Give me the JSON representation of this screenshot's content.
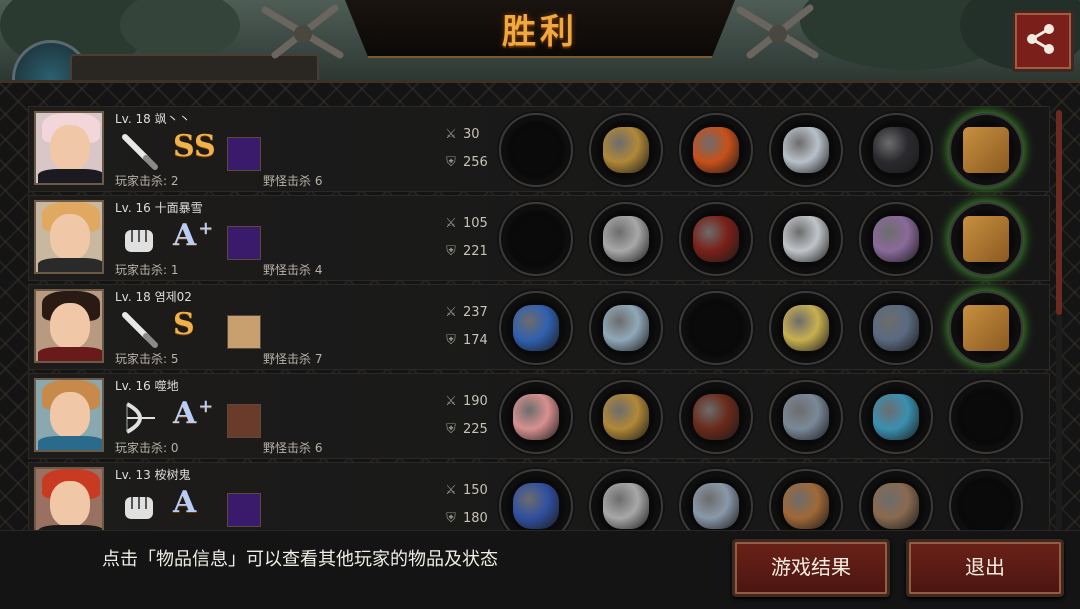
{
  "header": {
    "title": "胜利",
    "share_icon": "share-icon"
  },
  "players": [
    {
      "level": "Lv. 18 飒丶丶",
      "weapon_icon": "knife-icon",
      "grade": "SS",
      "grade_plus": "",
      "grade_color": "#f2b24a",
      "player_kills_label": "玩家击杀: 2",
      "monster_kills_label": "野怪击杀 6",
      "attack": "30",
      "defense": "256",
      "items": [
        "empty",
        "gold-helmet",
        "flaming-armor",
        "spiked-blade",
        "black-boots",
        "mystery-box"
      ]
    },
    {
      "level": "Lv. 16 十面暴雪",
      "weapon_icon": "fist-icon",
      "grade": "A",
      "grade_plus": "+",
      "grade_color": "#b9cdf5",
      "player_kills_label": "玩家击杀: 1",
      "monster_kills_label": "野怪击杀 4",
      "attack": "105",
      "defense": "221",
      "items": [
        "empty",
        "silver-helmet",
        "red-armor",
        "round-shield",
        "purple-boots",
        "mystery-box"
      ]
    },
    {
      "level": "Lv. 18 염제02",
      "weapon_icon": "knife-icon",
      "grade": "S",
      "grade_plus": "",
      "grade_color": "#f2b24a",
      "player_kills_label": "玩家击杀: 5",
      "monster_kills_label": "野怪击杀 7",
      "attack": "237",
      "defense": "174",
      "items": [
        "blue-sword",
        "steel-helmet",
        "empty",
        "gold-belt",
        "steel-boots",
        "mystery-box"
      ]
    },
    {
      "level": "Lv. 16 噬地",
      "weapon_icon": "bow-icon",
      "grade": "A",
      "grade_plus": "+",
      "grade_color": "#b9cdf5",
      "player_kills_label": "玩家击杀: 0",
      "monster_kills_label": "野怪击杀 6",
      "attack": "190",
      "defense": "225",
      "items": [
        "winged-bow",
        "gold-helmet",
        "heavy-armor",
        "ring-bracer",
        "cyber-boots",
        "empty"
      ]
    },
    {
      "level": "Lv. 13 桉树鬼",
      "weapon_icon": "fist-icon",
      "grade": "A",
      "grade_plus": "",
      "grade_color": "#b9cdf5",
      "player_kills_label": "",
      "monster_kills_label": "",
      "attack": "150",
      "defense": "180",
      "items": [
        "blue-gauntlet",
        "silver-helmet",
        "chain-mail",
        "bronze-bracer",
        "winged-boots",
        "empty"
      ]
    }
  ],
  "footer": {
    "hint": "点击「物品信息」可以查看其他玩家的物品及状态",
    "result_button": "游戏结果",
    "exit_button": "退出"
  }
}
